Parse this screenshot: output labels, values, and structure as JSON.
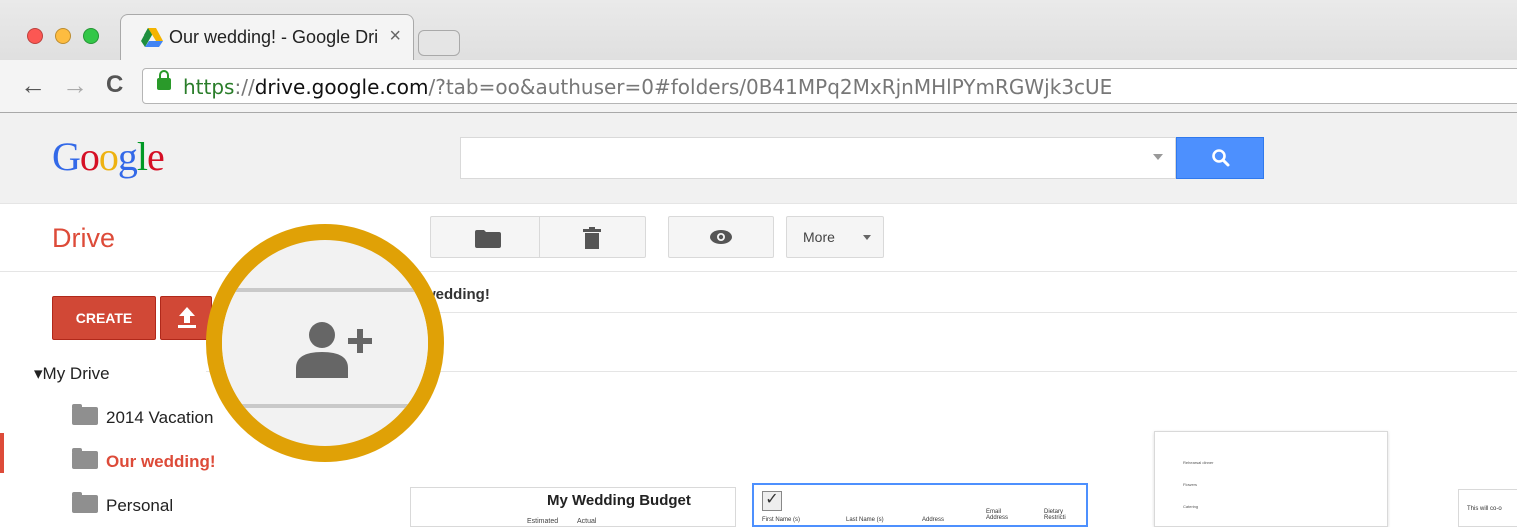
{
  "browser": {
    "tab_title": "Our wedding! - Google Dri",
    "tab_close": "×",
    "url_scheme": "https",
    "url_sep": "://",
    "url_host": "drive.google.com",
    "url_path": "/?tab=oo&authuser=0#folders/0B41MPq2MxRjnMHlPYmRGWjk3cUE",
    "back_glyph": "←",
    "forward_glyph": "→",
    "reload_glyph": "C"
  },
  "header": {
    "logo_letters": [
      "G",
      "o",
      "o",
      "g",
      "l",
      "e"
    ],
    "logo_colors": [
      "#3369e8",
      "#d50f25",
      "#eeb211",
      "#3369e8",
      "#009925",
      "#d50f25"
    ]
  },
  "drive": {
    "title": "Drive",
    "more_label": "More",
    "breadcrumb": "wedding!",
    "create_label": "CREATE",
    "upload_glyph": "↑"
  },
  "sidebar": {
    "my_drive": "▾My Drive",
    "items": [
      {
        "label": "2014 Vacation"
      },
      {
        "label": "Our wedding!"
      },
      {
        "label": "Personal"
      }
    ]
  },
  "files": {
    "budget_title": "My Wedding Budget",
    "budget_col1": "Estimated",
    "budget_col2": "Actual",
    "guest_headers": [
      "First Name (s)",
      "Last Name (s)",
      "Address",
      "Email Address",
      "Dietary Restricti"
    ],
    "doc_lines": [
      "Rehearsal dinner",
      "Flowers",
      "Catering"
    ],
    "right_doc_text": "This will co-o"
  },
  "colors": {
    "accent_red": "#dd4b39",
    "search_blue": "#4d90fe",
    "highlight_ring": "#e0a106"
  }
}
